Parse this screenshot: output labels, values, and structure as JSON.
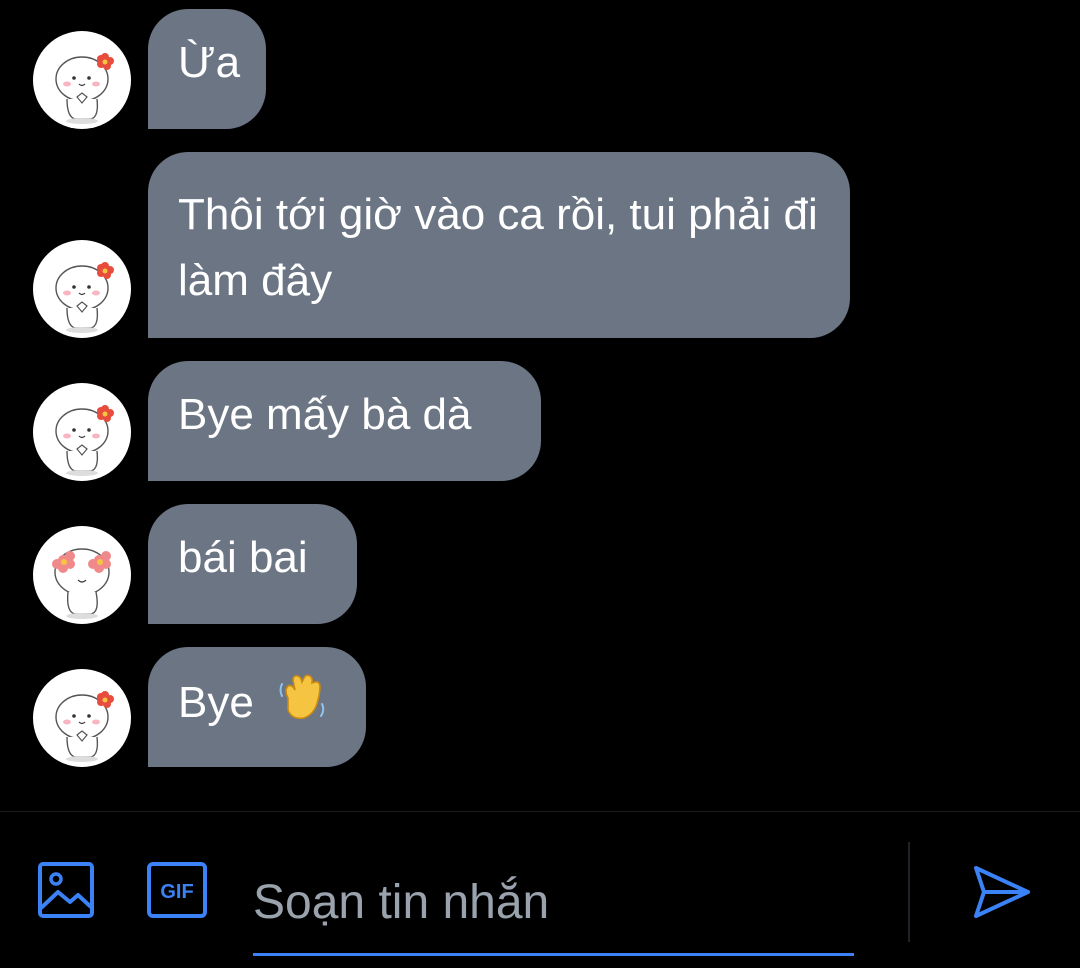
{
  "messages": [
    {
      "text": "Ừa",
      "avatar": "cute-blob-flower-avatar"
    },
    {
      "text": "Thôi tới giờ vào ca rồi, tui phải đi làm đây",
      "avatar": "cute-blob-flower-avatar"
    },
    {
      "text": "Bye mấy bà dà",
      "avatar": "cute-blob-flower-avatar"
    },
    {
      "text": "bái bai",
      "avatar": "cute-blob-flower-eyes-avatar"
    },
    {
      "text": "Bye",
      "emoji": "waving-hand-emoji",
      "avatar": "cute-blob-flower-avatar"
    }
  ],
  "composer": {
    "placeholder": "Soạn tin nhắn",
    "value": "",
    "gif_label": "GIF",
    "icons": [
      "image-icon",
      "gif-icon",
      "send-icon"
    ]
  },
  "colors": {
    "background": "#000000",
    "bubble": "#6b7584",
    "accent": "#3b82f6",
    "placeholder": "#9aa3ad"
  }
}
